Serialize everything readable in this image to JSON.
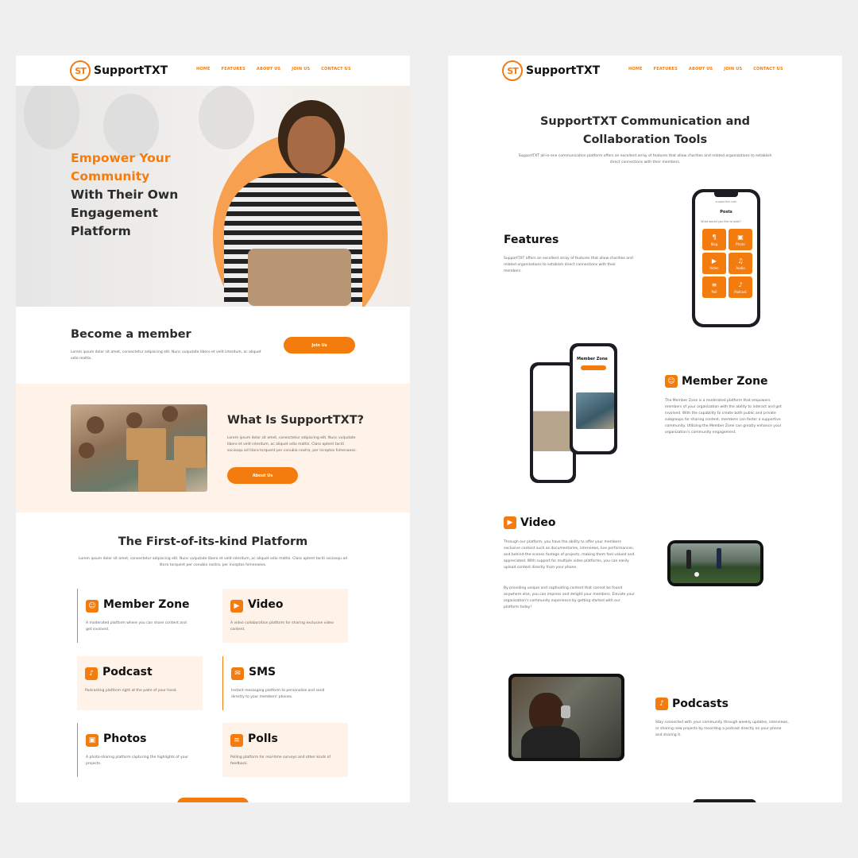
{
  "nav": {
    "brand": "SupportTXT",
    "logo_text": "ST",
    "links": [
      "HOME",
      "FEATURES",
      "ABOUT US",
      "JOIN US",
      "CONTACT US"
    ]
  },
  "hero": {
    "line1": "Empower Your",
    "line2": "Community",
    "line3": "With Their Own",
    "line4": "Engagement",
    "line5": "Platform"
  },
  "member": {
    "title": "Become a member",
    "text": "Lorem ipsum dolor sit amet, consectetur adipiscing elit. Nunc vulputate libero et velit interdum, ac aliquet odio mattis.",
    "button": "Join Us"
  },
  "what": {
    "title": "What Is SupportTXT?",
    "text": "Lorem ipsum dolor sit amet, consectetur adipiscing elit. Nunc vulputate libero et velit interdum, ac aliquet odio mattis. Class aptent taciti sociosqu ad litora torquent per conubia nostra, per inceptos himenaeos.",
    "button": "About Us"
  },
  "platform": {
    "title": "The First-of-its-kind Platform",
    "text": "Lorem ipsum dolor sit amet, consectetur adipiscing elit. Nunc vulputate libero et velit interdum, ac aliquet odio mattis. Class aptent taciti sociosqu ad litora torquent per conubia nostra, per inceptos himenaeos.",
    "cards": [
      {
        "title": "Member Zone",
        "text": "A moderated platform where you can share content and get involved."
      },
      {
        "title": "Video",
        "text": "A video collaboration platform for sharing exclusive video content."
      },
      {
        "title": "Podcast",
        "text": "Podcasting platform right at the palm of your hand."
      },
      {
        "title": "SMS",
        "text": "Instant messaging platform to personalize and send directly to your members' phones."
      },
      {
        "title": "Photos",
        "text": "A photo-sharing platform capturing the highlights of your projects."
      },
      {
        "title": "Polls",
        "text": "Polling platform for real-time surveys and other kinds of feedback."
      }
    ]
  },
  "right": {
    "title_line1": "SupportTXT Communication and",
    "title_line2": "Collaboration Tools",
    "intro": "SupportTXT all-in-one communication platform offers an excellent array of features that allow charities and related organizations to establish direct connections with their members.",
    "features": {
      "title": "Features",
      "text": "SupportTXT offers an excellent array of features that allow charities and related organizations to establish direct connections with their members."
    },
    "phone": {
      "url": "supporttxt.com",
      "header": "Posts",
      "prompt": "What would you like to post?",
      "tiles": [
        "Blog",
        "Photo",
        "Video",
        "Audio",
        "Poll",
        "Podcast"
      ]
    },
    "member_zone": {
      "title": "Member Zone",
      "text": "The Member Zone is a moderated platform that empowers members of your organization with the ability to interact and get involved. With the capability to create both public and private subgroups for sharing content, members can foster a supportive community. Utilizing the Member Zone can greatly enhance your organization's community engagement.",
      "phone_title": "Member Zone"
    },
    "video": {
      "title": "Video",
      "text1": "Through our platform, you have the ability to offer your members exclusive content such as documentaries, interviews, live performances, and behind-the-scenes footage of projects, making them feel valued and appreciated. With support for multiple video platforms, you can easily upload content directly from your phone.",
      "text2": "By providing unique and captivating content that cannot be found anywhere else, you can impress and delight your members. Elevate your organization's community experience by getting started with our platform today!"
    },
    "podcasts": {
      "title": "Podcasts",
      "text": "Stay connected with your community through weekly updates, interviews, or sharing new projects by recording a podcast directly on your phone and sharing it."
    }
  },
  "colors": {
    "accent": "#f47c0f",
    "tint": "#fff3e9"
  }
}
